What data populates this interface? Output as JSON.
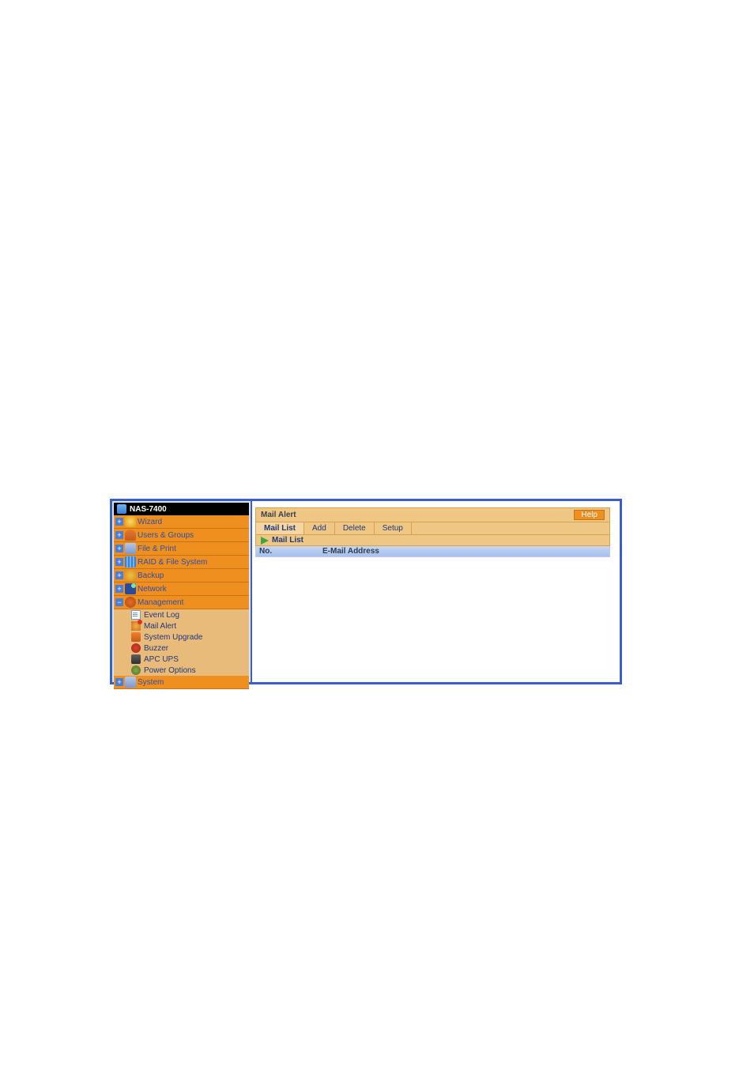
{
  "sidebar": {
    "title": "NAS-7400",
    "items": [
      {
        "label": "Wizard"
      },
      {
        "label": "Users & Groups"
      },
      {
        "label": "File & Print"
      },
      {
        "label": "RAID & File System"
      },
      {
        "label": "Backup"
      },
      {
        "label": "Network"
      },
      {
        "label": "Management",
        "expanded": true,
        "children": [
          {
            "label": "Event Log"
          },
          {
            "label": "Mail Alert"
          },
          {
            "label": "System Upgrade"
          },
          {
            "label": "Buzzer"
          },
          {
            "label": "APC UPS"
          },
          {
            "label": "Power Options"
          }
        ]
      },
      {
        "label": "System"
      }
    ]
  },
  "main": {
    "panel_title": "Mail Alert",
    "help_label": "Help",
    "tabs": [
      {
        "label": "Mail List",
        "active": true
      },
      {
        "label": "Add"
      },
      {
        "label": "Delete"
      },
      {
        "label": "Setup"
      }
    ],
    "section_label": "Mail List",
    "columns": {
      "no": "No.",
      "email": "E-Mail Address"
    }
  }
}
